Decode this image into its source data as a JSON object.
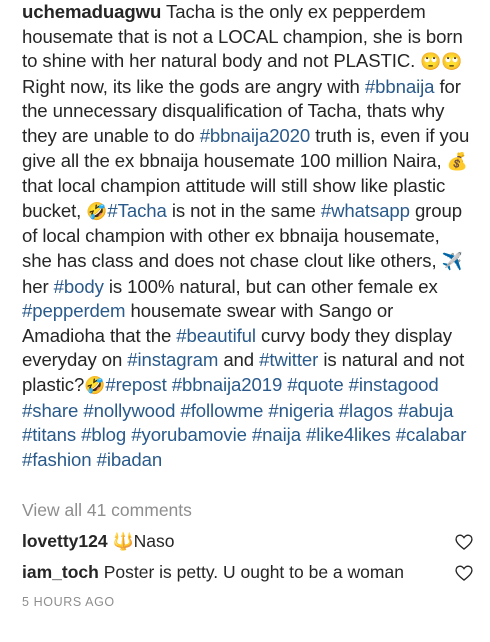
{
  "post": {
    "username": "uchemaduagwu",
    "segments": [
      {
        "t": "text",
        "v": " Tacha is the only ex pepperdem housemate that is not a LOCAL champion, she is born to shine with her natural body and not PLASTIC. "
      },
      {
        "t": "emoji",
        "v": "🙄🙄"
      },
      {
        "t": "text",
        "v": "Right now, its like the gods are angry with "
      },
      {
        "t": "tag",
        "v": "#bbnaija"
      },
      {
        "t": "text",
        "v": " for the unnecessary disqualification of Tacha, thats why they are unable to do "
      },
      {
        "t": "tag",
        "v": "#bbnaija2020"
      },
      {
        "t": "text",
        "v": " truth is, even if you give all the ex bbnaija housemate 100 million Naira, "
      },
      {
        "t": "emoji",
        "v": "💰"
      },
      {
        "t": "text",
        "v": " that local champion attitude will still show like plastic bucket, "
      },
      {
        "t": "emoji",
        "v": "🤣"
      },
      {
        "t": "tag",
        "v": "#Tacha"
      },
      {
        "t": "text",
        "v": " is not in the same "
      },
      {
        "t": "tag",
        "v": "#whatsapp"
      },
      {
        "t": "text",
        "v": " group of local champion with other ex bbnaija housemate, she has class and does not chase clout like others, "
      },
      {
        "t": "emoji",
        "v": "✈️"
      },
      {
        "t": "text",
        "v": "her "
      },
      {
        "t": "tag",
        "v": "#body"
      },
      {
        "t": "text",
        "v": " is 100% natural, but can other female ex "
      },
      {
        "t": "tag",
        "v": "#pepperdem"
      },
      {
        "t": "text",
        "v": " housemate swear with Sango or Amadioha that the "
      },
      {
        "t": "tag",
        "v": "#beautiful"
      },
      {
        "t": "text",
        "v": " curvy body they display everyday on "
      },
      {
        "t": "tag",
        "v": "#instagram"
      },
      {
        "t": "text",
        "v": " and "
      },
      {
        "t": "tag",
        "v": "#twitter"
      },
      {
        "t": "text",
        "v": " is natural and not plastic?"
      },
      {
        "t": "emoji",
        "v": "🤣"
      },
      {
        "t": "tag",
        "v": "#repost"
      },
      {
        "t": "text",
        "v": " "
      },
      {
        "t": "tag",
        "v": "#bbnaija2019"
      },
      {
        "t": "text",
        "v": " "
      },
      {
        "t": "tag",
        "v": "#quote"
      },
      {
        "t": "text",
        "v": " "
      },
      {
        "t": "tag",
        "v": "#instagood"
      },
      {
        "t": "text",
        "v": " "
      },
      {
        "t": "tag",
        "v": "#share"
      },
      {
        "t": "text",
        "v": " "
      },
      {
        "t": "tag",
        "v": "#nollywood"
      },
      {
        "t": "text",
        "v": " "
      },
      {
        "t": "tag",
        "v": "#followme"
      },
      {
        "t": "text",
        "v": " "
      },
      {
        "t": "tag",
        "v": "#nigeria"
      },
      {
        "t": "text",
        "v": " "
      },
      {
        "t": "tag",
        "v": "#lagos"
      },
      {
        "t": "text",
        "v": " "
      },
      {
        "t": "tag",
        "v": "#abuja"
      },
      {
        "t": "text",
        "v": " "
      },
      {
        "t": "tag",
        "v": "#titans"
      },
      {
        "t": "text",
        "v": " "
      },
      {
        "t": "tag",
        "v": "#blog"
      },
      {
        "t": "text",
        "v": " "
      },
      {
        "t": "tag",
        "v": "#yorubamovie"
      },
      {
        "t": "text",
        "v": " "
      },
      {
        "t": "tag",
        "v": "#naija"
      },
      {
        "t": "text",
        "v": " "
      },
      {
        "t": "tag",
        "v": "#like4likes"
      },
      {
        "t": "text",
        "v": " "
      },
      {
        "t": "tag",
        "v": "#calabar"
      },
      {
        "t": "text",
        "v": " "
      },
      {
        "t": "tag",
        "v": "#fashion"
      },
      {
        "t": "text",
        "v": " "
      },
      {
        "t": "tag",
        "v": "#ibadan"
      }
    ]
  },
  "view_all_comments": "View all 41 comments",
  "comments": [
    {
      "username": "lovetty124",
      "emoji": "🔱",
      "text": "Naso",
      "heart_icon": "heart-outline-icon"
    },
    {
      "username": "iam_toch",
      "emoji": "",
      "text": " Poster is petty. U ought to be a woman",
      "heart_icon": "heart-outline-icon"
    }
  ],
  "timestamp": "5 HOURS AGO",
  "colors": {
    "text": "#262626",
    "hashtag": "#2a5a8a",
    "muted": "#8e8e8e"
  }
}
